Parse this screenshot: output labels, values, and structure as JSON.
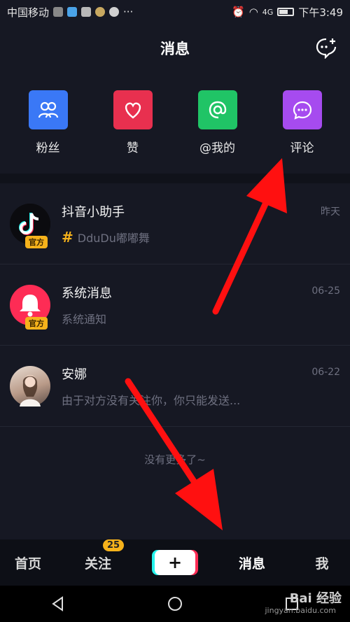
{
  "status": {
    "carrier": "中国移动",
    "dots": "···",
    "time": "下午3:49",
    "signal": "4G"
  },
  "header": {
    "title": "消息"
  },
  "quick_actions": [
    {
      "label": "粉丝",
      "color": "#3a78f6",
      "icon": "fans-icon"
    },
    {
      "label": "赞",
      "color": "#e8304f",
      "icon": "heart-icon"
    },
    {
      "label": "@我的",
      "color": "#20c466",
      "icon": "at-icon"
    },
    {
      "label": "评论",
      "color": "#a64bef",
      "icon": "comment-icon"
    }
  ],
  "messages": [
    {
      "name": "抖音小助手",
      "preview": "DduDu嘟嘟舞",
      "time": "昨天",
      "badge": "官方"
    },
    {
      "name": "系统消息",
      "preview": "系统通知",
      "time": "06-25",
      "badge": "官方"
    },
    {
      "name": "安娜",
      "preview": "由于对方没有关注你，你只能发送...",
      "time": "06-22"
    }
  ],
  "no_more": "没有更多了~",
  "tabs": {
    "home": "首页",
    "follow": "关注",
    "follow_badge": "25",
    "add": "+",
    "messages": "消息",
    "me": "我"
  },
  "watermark": {
    "main": "Bai 经验",
    "sub": "jingyan.baidu.com"
  }
}
